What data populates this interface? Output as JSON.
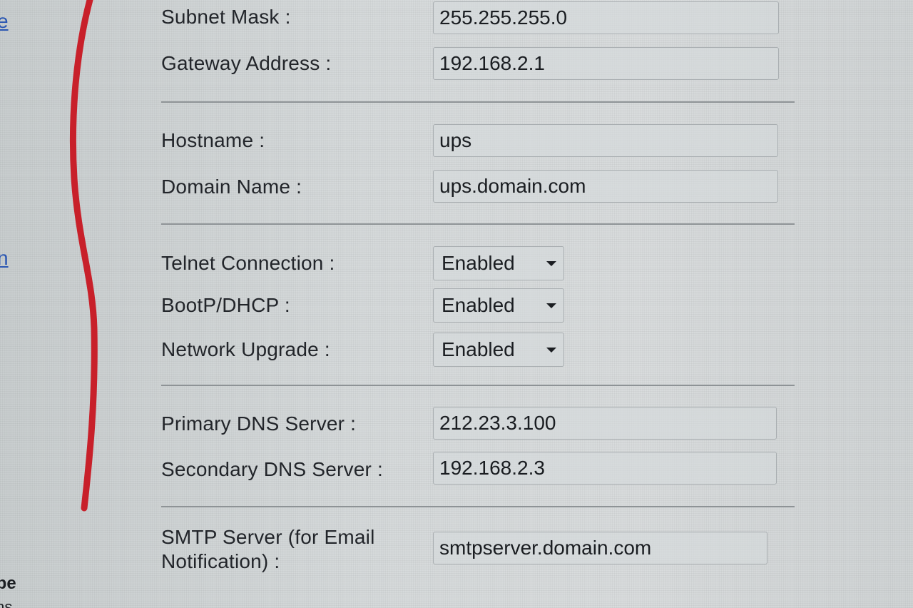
{
  "sidebar": {
    "link_top": "e",
    "link_mid": "n",
    "bold_text": "ibe",
    "cut_text": "ms"
  },
  "network": {
    "subnet_mask": {
      "label": "Subnet Mask :",
      "value": "255.255.255.0"
    },
    "gateway": {
      "label": "Gateway Address :",
      "value": "192.168.2.1"
    }
  },
  "host": {
    "hostname": {
      "label": "Hostname :",
      "value": "ups"
    },
    "domain": {
      "label": "Domain Name :",
      "value": "ups.domain.com"
    }
  },
  "services": {
    "telnet": {
      "label": "Telnet Connection :",
      "value": "Enabled"
    },
    "bootp": {
      "label": "BootP/DHCP :",
      "value": "Enabled"
    },
    "upgrade": {
      "label": "Network Upgrade :",
      "value": "Enabled"
    }
  },
  "dns": {
    "primary": {
      "label": "Primary DNS Server :",
      "value": "212.23.3.100"
    },
    "secondary": {
      "label": "Secondary DNS Server :",
      "value": "192.168.2.3"
    }
  },
  "smtp": {
    "label": "SMTP Server (for Email Notification) :",
    "value": "smtpserver.domain.com"
  },
  "colors": {
    "accent_curve": "#c8202a",
    "link": "#2b57b3"
  }
}
